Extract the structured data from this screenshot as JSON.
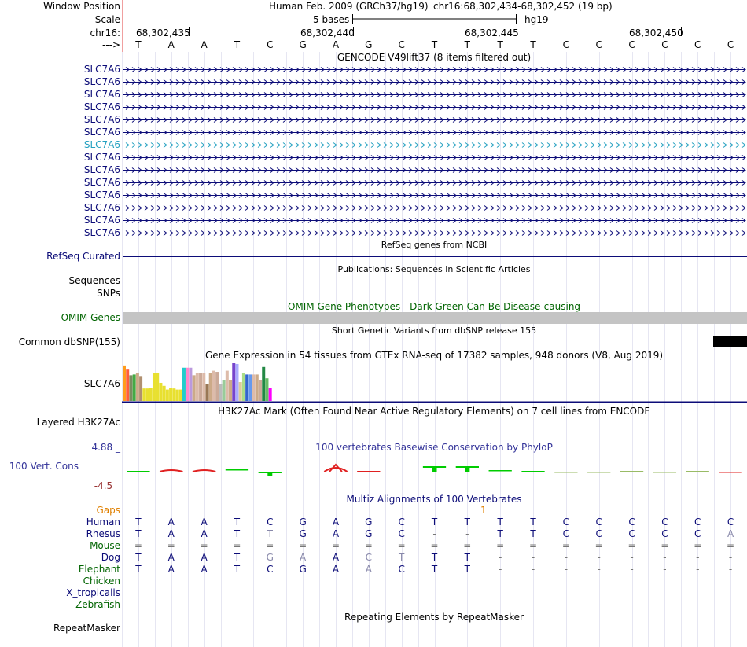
{
  "header": {
    "window_position_label": "Window Position",
    "scale_label": "Scale",
    "chrom_label": "chr16:",
    "arrow_label": "--->",
    "assembly_title": "Human Feb. 2009 (GRCh37/hg19)",
    "position_text": "chr16:68,302,434-68,302,452 (19 bp)",
    "scale_text": "5 bases",
    "scale_db": "hg19",
    "coords": [
      "68,302,435",
      "68,302,440",
      "68,302,445",
      "68,302,450"
    ]
  },
  "bases": [
    "T",
    "A",
    "A",
    "T",
    "C",
    "G",
    "A",
    "G",
    "C",
    "T",
    "T",
    "T",
    "T",
    "C",
    "C",
    "C",
    "C",
    "C",
    "C"
  ],
  "gencode": {
    "title": "GENCODE V49lift37 (8 items filtered out)",
    "items": [
      "SLC7A6",
      "SLC7A6",
      "SLC7A6",
      "SLC7A6",
      "SLC7A6",
      "SLC7A6",
      "SLC7A6",
      "SLC7A6",
      "SLC7A6",
      "SLC7A6",
      "SLC7A6",
      "SLC7A6",
      "SLC7A6",
      "SLC7A6"
    ],
    "highlight_index": 6,
    "colors": {
      "normal": "#0c0c78",
      "highlight": "#23a0c0"
    }
  },
  "refseq": {
    "label": "RefSeq Curated",
    "title": "RefSeq genes from NCBI",
    "color": "#0c0c78"
  },
  "publications": {
    "label": "Sequences",
    "title": "Publications: Sequences in Scientific Articles"
  },
  "snps": {
    "label": "SNPs"
  },
  "omim": {
    "label": "OMIM Genes",
    "title": "OMIM Gene Phenotypes - Dark Green Can Be Disease-causing",
    "color": "#006400"
  },
  "dbsnp": {
    "label": "Common dbSNP(155)",
    "title": "Short Genetic Variants from dbSNP release 155"
  },
  "gtex": {
    "label": "SLC7A6",
    "title": "Gene Expression in 54 tissues from GTEx RNA-seq of 17382 samples, 948 donors (V8, Aug 2019)",
    "bars": [
      {
        "level": 0.94,
        "color": "#ff9c1c"
      },
      {
        "level": 0.83,
        "color": "#ff5c3c"
      },
      {
        "level": 0.68,
        "color": "#7a8c60"
      },
      {
        "level": 0.7,
        "color": "#44aa44"
      },
      {
        "level": 0.73,
        "color": "#ccaa88"
      },
      {
        "level": 0.66,
        "color": "#b09070"
      },
      {
        "level": 0.33,
        "color": "#e8e030"
      },
      {
        "level": 0.33,
        "color": "#e8e030"
      },
      {
        "level": 0.35,
        "color": "#e8e030"
      },
      {
        "level": 0.73,
        "color": "#e8e030"
      },
      {
        "level": 0.73,
        "color": "#e8e030"
      },
      {
        "level": 0.48,
        "color": "#e8e030"
      },
      {
        "level": 0.4,
        "color": "#e8e030"
      },
      {
        "level": 0.3,
        "color": "#e8e030"
      },
      {
        "level": 0.35,
        "color": "#e8e030"
      },
      {
        "level": 0.33,
        "color": "#e8e030"
      },
      {
        "level": 0.3,
        "color": "#e8e030"
      },
      {
        "level": 0.3,
        "color": "#e8e030"
      },
      {
        "level": 0.88,
        "color": "#22cccc"
      },
      {
        "level": 0.88,
        "color": "#ff88cc"
      },
      {
        "level": 0.88,
        "color": "#bb99dd"
      },
      {
        "level": 0.68,
        "color": "#ccaa88"
      },
      {
        "level": 0.73,
        "color": "#ddbbaa"
      },
      {
        "level": 0.73,
        "color": "#ccaa99"
      },
      {
        "level": 0.73,
        "color": "#ddbbaa"
      },
      {
        "level": 0.45,
        "color": "#997755"
      },
      {
        "level": 0.73,
        "color": "#ccaa88"
      },
      {
        "level": 0.8,
        "color": "#ddbbaa"
      },
      {
        "level": 0.77,
        "color": "#ccaa99"
      },
      {
        "level": 0.45,
        "color": "#bbbbbb"
      },
      {
        "level": 0.55,
        "color": "#99cc99"
      },
      {
        "level": 0.8,
        "color": "#ddbbaa"
      },
      {
        "level": 0.55,
        "color": "#ccaa88"
      },
      {
        "level": 1.0,
        "color": "#7744cc"
      },
      {
        "level": 0.98,
        "color": "#aaaaff"
      },
      {
        "level": 0.5,
        "color": "#ddcc99"
      },
      {
        "level": 0.73,
        "color": "#aadd88"
      },
      {
        "level": 0.7,
        "color": "#3366cc"
      },
      {
        "level": 0.7,
        "color": "#6699ee"
      },
      {
        "level": 0.7,
        "color": "#ddbbaa"
      },
      {
        "level": 0.7,
        "color": "#ccaa88"
      },
      {
        "level": 0.55,
        "color": "#ccaa99"
      },
      {
        "level": 0.9,
        "color": "#228844"
      },
      {
        "level": 0.6,
        "color": "#66bb66"
      },
      {
        "level": 0.35,
        "color": "#ff00ff"
      }
    ]
  },
  "h3k27ac": {
    "label": "Layered H3K27Ac",
    "title": "H3K27Ac Mark (Often Found Near Active Regulatory Elements) on 7 cell lines from ENCODE"
  },
  "phylop": {
    "label": "100 Vert. Cons",
    "max_label": "4.88 _",
    "min_label": "-4.5 _",
    "title": "100 vertebrates Basewise Conservation by PhyloP",
    "color": "#333399"
  },
  "multiz": {
    "title": "Multiz Alignments of 100 Vertebrates",
    "gaps_label": "Gaps",
    "gap_marker": "1",
    "species": [
      {
        "name": "Human",
        "color": "#0c0c78",
        "seq": [
          "T",
          "A",
          "A",
          "T",
          "C",
          "G",
          "A",
          "G",
          "C",
          "T",
          "T",
          "T",
          "T",
          "C",
          "C",
          "C",
          "C",
          "C",
          "C"
        ]
      },
      {
        "name": "Rhesus",
        "color": "#0c0c78",
        "seq": [
          "T",
          "A",
          "A",
          "T",
          "T",
          "G",
          "A",
          "G",
          "C",
          "-",
          "-",
          "T",
          "T",
          "C",
          "C",
          "C",
          "C",
          "C",
          "A"
        ]
      },
      {
        "name": "Mouse",
        "color": "#006400",
        "seq": [
          "=",
          "=",
          "=",
          "=",
          "=",
          "=",
          "=",
          "=",
          "=",
          "=",
          "=",
          "=",
          "=",
          "=",
          "=",
          "=",
          "=",
          "=",
          "="
        ]
      },
      {
        "name": "Dog",
        "color": "#0c0c78",
        "seq": [
          "T",
          "A",
          "A",
          "T",
          "G",
          "A",
          "A",
          "C",
          "T",
          "T",
          "T",
          "-",
          "-",
          "-",
          "-",
          "-",
          "-",
          "-",
          "-"
        ]
      },
      {
        "name": "Elephant",
        "color": "#006400",
        "seq": [
          "T",
          "A",
          "A",
          "T",
          "C",
          "G",
          "A",
          "A",
          "C",
          "T",
          "T",
          "-",
          "-",
          "-",
          "-",
          "-",
          "-",
          "-",
          "-"
        ]
      },
      {
        "name": "Chicken",
        "color": "#006400",
        "seq": []
      },
      {
        "name": "X_tropicalis",
        "color": "#0c0c78",
        "seq": []
      },
      {
        "name": "Zebrafish",
        "color": "#006400",
        "seq": []
      }
    ]
  },
  "repeatmasker": {
    "label": "RepeatMasker",
    "title": "Repeating Elements by RepeatMasker"
  }
}
